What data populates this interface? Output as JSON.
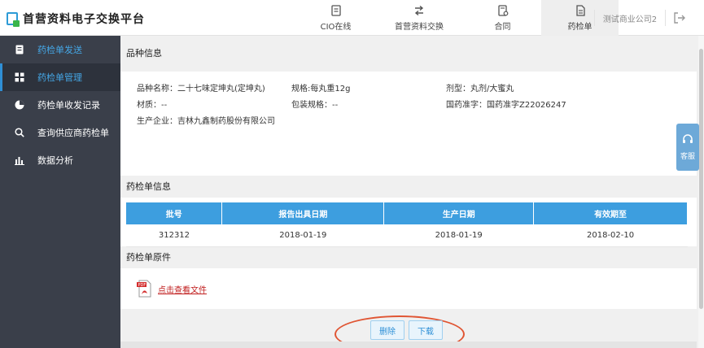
{
  "app": {
    "title": "首营资料电子交换平台"
  },
  "nav": {
    "items": [
      {
        "label": "CIO在线",
        "icon": "document-icon",
        "active": false
      },
      {
        "label": "首营资料交换",
        "icon": "exchange-arrows-icon",
        "active": false
      },
      {
        "label": "合同",
        "icon": "contract-icon",
        "active": false
      },
      {
        "label": "药检单",
        "icon": "file-icon",
        "active": true
      }
    ]
  },
  "user": {
    "company": "测试商业公司2"
  },
  "sidebar": {
    "items": [
      {
        "label": "药检单发送",
        "icon": "document-icon",
        "active": false
      },
      {
        "label": "药检单管理",
        "icon": "grid-icon",
        "active": true
      },
      {
        "label": "药检单收发记录",
        "icon": "pie-chart-icon",
        "active": false
      },
      {
        "label": "查询供应商药检单",
        "icon": "search-icon",
        "active": false
      },
      {
        "label": "数据分析",
        "icon": "bar-chart-icon",
        "active": false
      }
    ]
  },
  "product": {
    "title": "品种信息",
    "name": "品种名称：二十七味定坤丸(定坤丸)",
    "spec": "规格:每丸重12g",
    "form": "剂型：丸剂/大蜜丸",
    "material": "材质：--",
    "package": "包装规格：--",
    "approval": "国药准字：国药准字Z22026247",
    "maker": "生产企业：吉林九鑫制药股份有限公司"
  },
  "batch": {
    "title": "药检单信息",
    "headers": [
      "批号",
      "报告出具日期",
      "生产日期",
      "有效期至"
    ],
    "rows": [
      [
        "312312",
        "2018-01-19",
        "2018-01-19",
        "2018-02-10"
      ]
    ]
  },
  "original": {
    "title": "药检单原件",
    "link": "点击查看文件",
    "icon": "pdf-file-icon"
  },
  "actions": {
    "delete": "删除",
    "download": "下载"
  },
  "service": {
    "label": "客服",
    "icon": "headset-icon"
  },
  "colors": {
    "accent": "#3d9edf",
    "sidebar": "#3a3f4a",
    "highlight": "#e05533",
    "link": "#c01e1e"
  }
}
